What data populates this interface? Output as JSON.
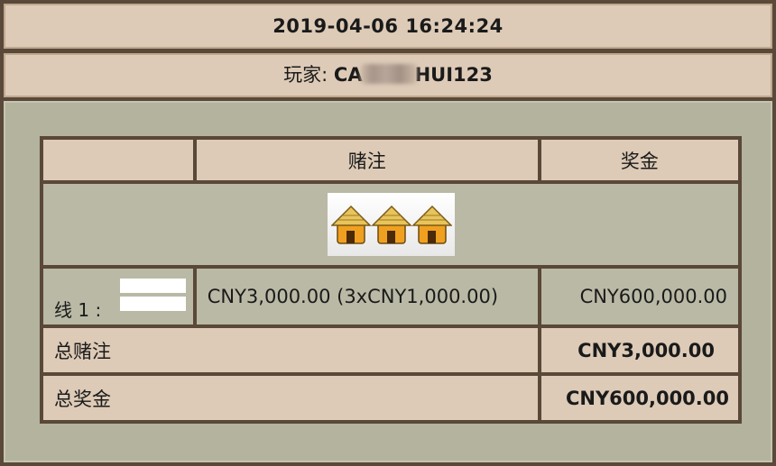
{
  "header": {
    "datetime": "2019-04-06 16:24:24"
  },
  "player": {
    "label": "玩家:",
    "name_start": "CA",
    "name_end": "HUI123"
  },
  "table": {
    "headers": [
      "",
      "赌注",
      "奖金"
    ],
    "symbols": [
      "hut-icon",
      "hut-icon",
      "hut-icon"
    ],
    "line": {
      "label": "线 1 :",
      "bet": "CNY3,000.00 (3xCNY1,000.00)",
      "prize": "CNY600,000.00"
    },
    "total_bet": {
      "label": "总赌注",
      "value": "CNY3,000.00"
    },
    "total_prize": {
      "label": "总奖金",
      "value": "CNY600,000.00"
    }
  },
  "colors": {
    "frame": "#5a4838",
    "bar": "#ddcbb7",
    "panel": "#b3b39e",
    "hut_roof": "#e8b23a",
    "hut_wall": "#f0a020"
  }
}
